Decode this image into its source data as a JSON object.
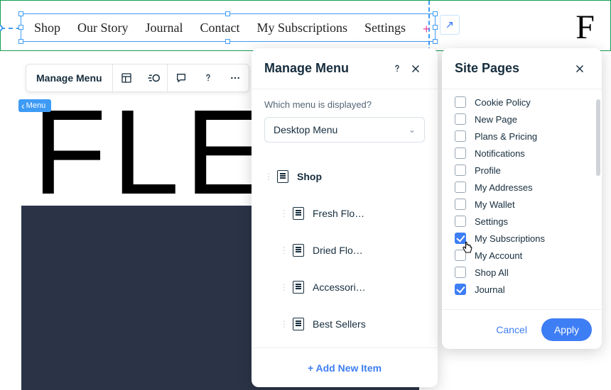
{
  "nav": {
    "items": [
      "Shop",
      "Our Story",
      "Journal",
      "Contact",
      "My Subscriptions",
      "Settings"
    ]
  },
  "brand_letter": "F",
  "big_background_text": "FLE",
  "toolbar": {
    "label": "Manage Menu"
  },
  "menu_tag": "Menu",
  "manage_panel": {
    "title": "Manage Menu",
    "which_label": "Which menu is displayed?",
    "select_value": "Desktop Menu",
    "items": [
      {
        "label": "Shop",
        "level": 0
      },
      {
        "label": "Fresh Flo…",
        "level": 1
      },
      {
        "label": "Dried Flo…",
        "level": 1
      },
      {
        "label": "Accessori…",
        "level": 1
      },
      {
        "label": "Best Sellers",
        "level": 1
      }
    ],
    "add_label": "+ Add New Item"
  },
  "pages_panel": {
    "title": "Site Pages",
    "items": [
      {
        "label": "Cookie Policy",
        "checked": false
      },
      {
        "label": "New Page",
        "checked": false
      },
      {
        "label": "Plans & Pricing",
        "checked": false
      },
      {
        "label": "Notifications",
        "checked": false
      },
      {
        "label": "Profile",
        "checked": false
      },
      {
        "label": "My Addresses",
        "checked": false
      },
      {
        "label": "My Wallet",
        "checked": false
      },
      {
        "label": "Settings",
        "checked": false
      },
      {
        "label": "My Subscriptions",
        "checked": true
      },
      {
        "label": "My Account",
        "checked": false
      },
      {
        "label": "Shop All",
        "checked": false
      },
      {
        "label": "Journal",
        "checked": true
      }
    ],
    "cancel": "Cancel",
    "apply": "Apply"
  }
}
